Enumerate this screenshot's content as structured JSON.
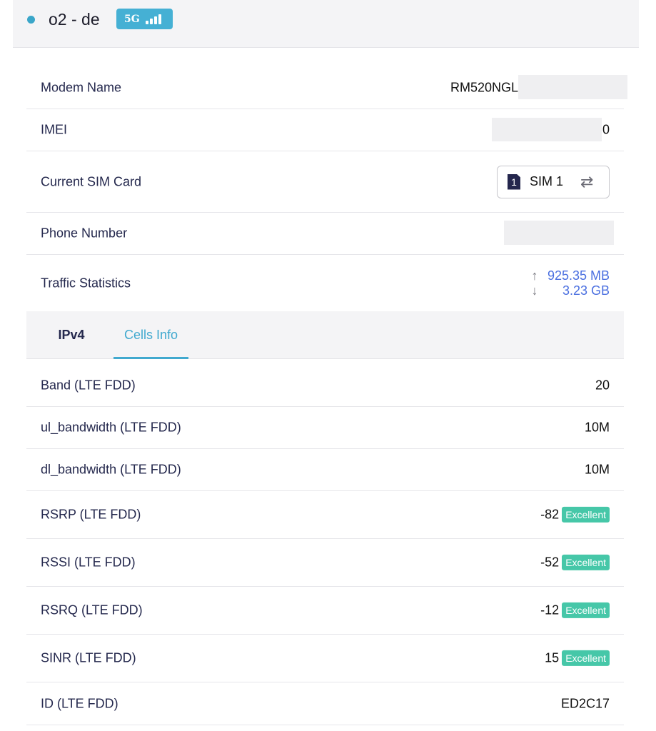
{
  "header": {
    "operator": "o2 - de",
    "network_gen": "5G",
    "signal_icon": "signal-bars-icon",
    "colors": {
      "badge": "#45b0d4",
      "dot": "#3aa6c9"
    }
  },
  "device": {
    "modem_name_label": "Modem Name",
    "modem_name_value": "RM520NGL",
    "imei_label": "IMEI",
    "imei_value": "0",
    "sim_label": "Current SIM Card",
    "sim_number": "1",
    "sim_value": "SIM 1",
    "phone_label": "Phone Number",
    "traffic_label": "Traffic Statistics",
    "traffic_up": "925.35 MB",
    "traffic_down": "3.23 GB"
  },
  "tabs": [
    {
      "label": "IPv4",
      "active": false
    },
    {
      "label": "Cells Info",
      "active": true
    }
  ],
  "cells": [
    {
      "label": "Band (LTE FDD)",
      "value": "20"
    },
    {
      "label": "ul_bandwidth (LTE FDD)",
      "value": "10M"
    },
    {
      "label": "dl_bandwidth (LTE FDD)",
      "value": "10M"
    },
    {
      "label": "RSRP (LTE FDD)",
      "value": "-82",
      "quality": "Excellent"
    },
    {
      "label": "RSSI (LTE FDD)",
      "value": "-52",
      "quality": "Excellent"
    },
    {
      "label": "RSRQ (LTE FDD)",
      "value": "-12",
      "quality": "Excellent"
    },
    {
      "label": "SINR (LTE FDD)",
      "value": "15",
      "quality": "Excellent"
    },
    {
      "label": "ID (LTE FDD)",
      "value": "ED2C17"
    }
  ],
  "colors": {
    "accent": "#41a9cf",
    "traffic": "#4a6fe0",
    "excellent": "#46c7a8"
  }
}
